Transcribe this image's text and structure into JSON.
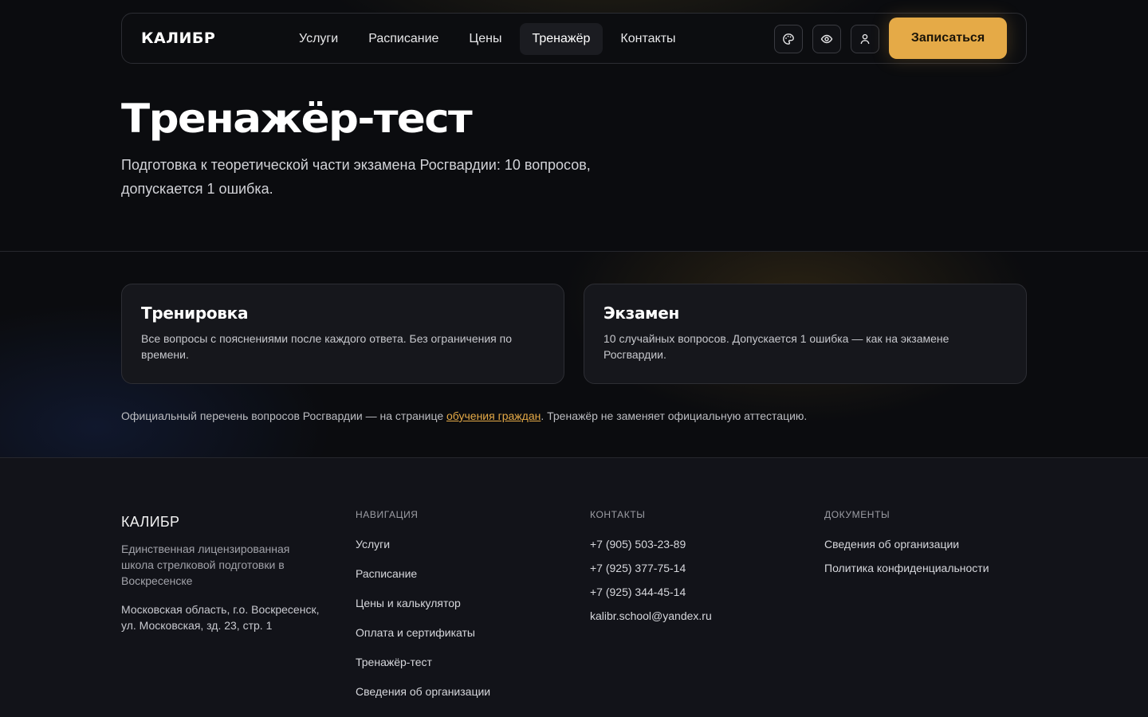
{
  "header": {
    "logo": "КАЛИБР",
    "nav": [
      "Услуги",
      "Расписание",
      "Цены",
      "Тренажёр",
      "Контакты"
    ],
    "active_nav": "Тренажёр",
    "icons": [
      "palette-icon",
      "eye-icon",
      "user-icon"
    ],
    "cta_label": "Записаться"
  },
  "hero": {
    "title": "Тренажёр-тест",
    "subtitle": "Подготовка к теоретической части экзамена Росгвардии: 10 вопросов, допускается 1 ошибка."
  },
  "modes": [
    {
      "title": "Тренировка",
      "text": "Все вопросы с пояснениями после каждого ответа. Без ограничения по времени."
    },
    {
      "title": "Экзамен",
      "text": "10 случайных вопросов. Допускается 1 ошибка — как на экзамене Росгвардии."
    }
  ],
  "note": {
    "before": "Официальный перечень вопросов Росгвардии — на странице ",
    "link": "обучения граждан",
    "after": ". Тренажёр не заменяет официальную аттестацию."
  },
  "footer": {
    "logo": "КАЛИБР",
    "description": "Единственная лицензированная школа стрелковой подготовки в Воскресенске",
    "address": "Московская область, г.о. Воскресенск, ул. Московская, зд. 23, стр. 1",
    "navigation": {
      "heading": "НАВИГАЦИЯ",
      "links": [
        "Услуги",
        "Расписание",
        "Цены и калькулятор",
        "Оплата и сертификаты",
        "Тренажёр-тест",
        "Сведения об организации"
      ]
    },
    "contacts": {
      "heading": "КОНТАКТЫ",
      "items": [
        "+7 (905) 503-23-89",
        "+7 (925) 377-75-14",
        "+7 (925) 344-45-14",
        "kalibr.school@yandex.ru"
      ]
    },
    "documents": {
      "heading": "ДОКУМЕНТЫ",
      "links": [
        "Сведения об организации",
        "Политика конфиденциальности"
      ]
    }
  },
  "colors": {
    "background": "#0b0c0f",
    "accent": "#e5aa47",
    "card": "#16171c",
    "footer": "#121319"
  }
}
